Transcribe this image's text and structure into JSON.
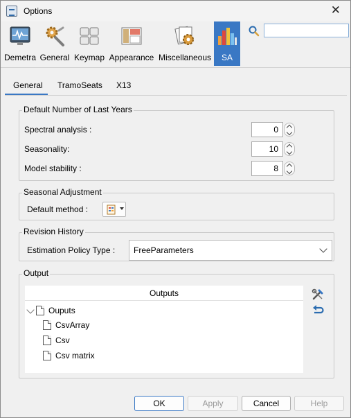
{
  "window": {
    "title": "Options"
  },
  "toolbar": {
    "items": [
      {
        "label": "Demetra",
        "icon": "monitor-icon"
      },
      {
        "label": "General",
        "icon": "gears-icon"
      },
      {
        "label": "Keymap",
        "icon": "keyboard-icon"
      },
      {
        "label": "Appearance",
        "icon": "appearance-icon"
      },
      {
        "label": "Miscellaneous",
        "icon": "misc-icon"
      },
      {
        "label": "SA",
        "icon": "bar-chart-icon",
        "selected": true
      }
    ],
    "search": {
      "value": "",
      "placeholder": ""
    }
  },
  "tabs": [
    {
      "label": "General",
      "active": true
    },
    {
      "label": "TramoSeats",
      "active": false
    },
    {
      "label": "X13",
      "active": false
    }
  ],
  "default_last_years": {
    "title": "Default Number of Last Years",
    "rows": [
      {
        "label": "Spectral analysis :",
        "value": "0"
      },
      {
        "label": "Seasonality:",
        "value": "10"
      },
      {
        "label": "Model stability :",
        "value": "8"
      }
    ]
  },
  "seasonal_adjustment": {
    "title": "Seasonal Adjustment",
    "method_label": "Default method :"
  },
  "revision_history": {
    "title": "Revision History",
    "policy_label": "Estimation Policy Type :",
    "policy_value": "FreeParameters"
  },
  "output": {
    "title": "Output",
    "header": "Outputs",
    "root": "Ouputs",
    "children": [
      "CsvArray",
      "Csv",
      "Csv matrix"
    ]
  },
  "buttons": {
    "ok": "OK",
    "apply": "Apply",
    "cancel": "Cancel",
    "help": "Help"
  },
  "colors": {
    "accent": "#3a78c4",
    "background": "#f0f0f0"
  }
}
